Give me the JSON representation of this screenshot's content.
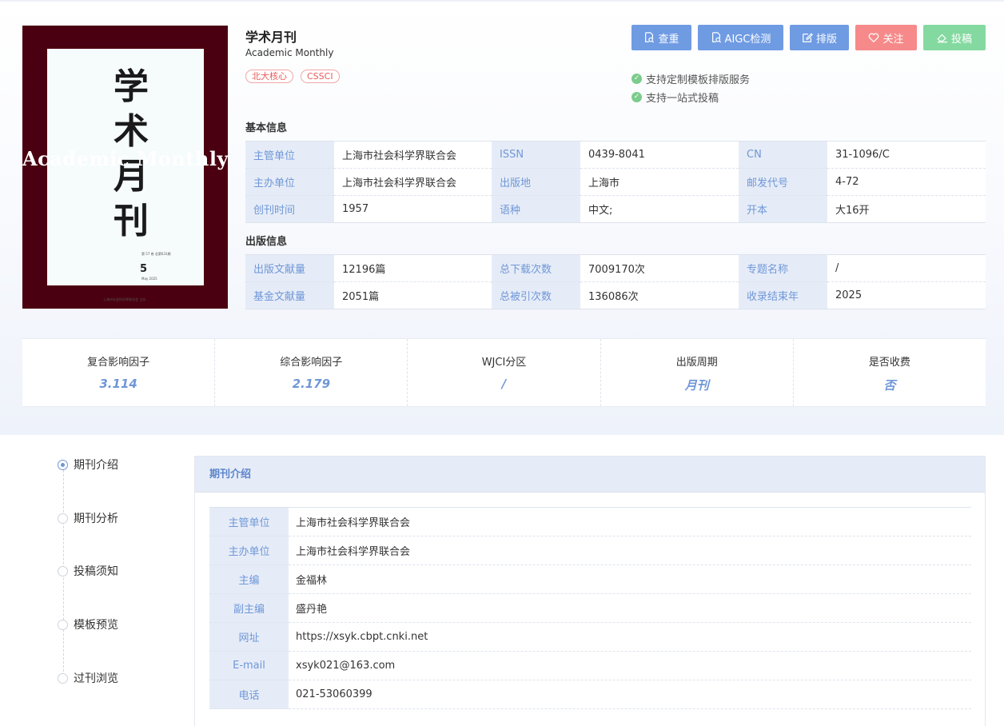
{
  "journal": {
    "title": "学术月刊",
    "subtitle": "Academic Monthly",
    "tags": [
      "北大核心",
      "CSSCI"
    ]
  },
  "cover": {
    "calligraphy": [
      "学",
      "术",
      "月",
      "刊"
    ],
    "overlay_text": "Academic Monthly",
    "issue_line": "第 57 卷 总第631期",
    "issue_number": "5",
    "issue_date": "May 2025",
    "publisher_line": "上海市社会科学界联合会 主办"
  },
  "actions": [
    {
      "label": "查重",
      "icon": "search-doc-icon",
      "color": "#6f9be3"
    },
    {
      "label": "AIGC检测",
      "icon": "search-doc-icon",
      "color": "#6f9be3"
    },
    {
      "label": "排版",
      "icon": "edit-icon",
      "color": "#6f9be3"
    },
    {
      "label": "关注",
      "icon": "heart-icon",
      "color": "#f68a8a"
    },
    {
      "label": "投稿",
      "icon": "eraser-icon",
      "color": "#84d9a0"
    }
  ],
  "support": [
    "支持定制模板排版服务",
    "支持一站式投稿"
  ],
  "basic_info": {
    "heading": "基本信息",
    "rows": [
      [
        {
          "label": "主管单位",
          "value": "上海市社会科学界联合会"
        },
        {
          "label": "ISSN",
          "value": "0439-8041"
        },
        {
          "label": "CN",
          "value": "31-1096/C"
        }
      ],
      [
        {
          "label": "主办单位",
          "value": "上海市社会科学界联合会"
        },
        {
          "label": "出版地",
          "value": "上海市"
        },
        {
          "label": "邮发代号",
          "value": "4-72"
        }
      ],
      [
        {
          "label": "创刊时间",
          "value": "1957"
        },
        {
          "label": "语种",
          "value": "中文;"
        },
        {
          "label": "开本",
          "value": "大16开"
        }
      ]
    ]
  },
  "publish_info": {
    "heading": "出版信息",
    "rows": [
      [
        {
          "label": "出版文献量",
          "value": "12196篇"
        },
        {
          "label": "总下载次数",
          "value": "7009170次"
        },
        {
          "label": "专题名称",
          "value": "/"
        }
      ],
      [
        {
          "label": "基金文献量",
          "value": "2051篇"
        },
        {
          "label": "总被引次数",
          "value": "136086次"
        },
        {
          "label": "收录结束年",
          "value": "2025"
        }
      ]
    ]
  },
  "metrics": [
    {
      "label": "复合影响因子",
      "value": "3.114"
    },
    {
      "label": "综合影响因子",
      "value": "2.179"
    },
    {
      "label": "WJCI分区",
      "value": "/"
    },
    {
      "label": "出版周期",
      "value": "月刊"
    },
    {
      "label": "是否收费",
      "value": "否"
    }
  ],
  "nav": [
    {
      "label": "期刊介绍",
      "active": true
    },
    {
      "label": "期刊分析",
      "active": false
    },
    {
      "label": "投稿须知",
      "active": false
    },
    {
      "label": "模板预览",
      "active": false
    },
    {
      "label": "过刊浏览",
      "active": false
    }
  ],
  "intro": {
    "heading": "期刊介绍",
    "rows": [
      {
        "label": "主管单位",
        "value": "上海市社会科学界联合会"
      },
      {
        "label": "主办单位",
        "value": "上海市社会科学界联合会"
      },
      {
        "label": "主编",
        "value": "金福林"
      },
      {
        "label": "副主编",
        "value": "盛丹艳"
      },
      {
        "label": "网址",
        "value": "https://xsyk.cbpt.cnki.net"
      },
      {
        "label": "E-mail",
        "value": "xsyk021@163.com"
      },
      {
        "label": "电话",
        "value": "021-53060399"
      }
    ]
  },
  "colors": {
    "accent": "#6f97d8",
    "label_bg": "#e6ecf7",
    "cover_bg": "#4a0010",
    "tag": "#e85a5a"
  }
}
